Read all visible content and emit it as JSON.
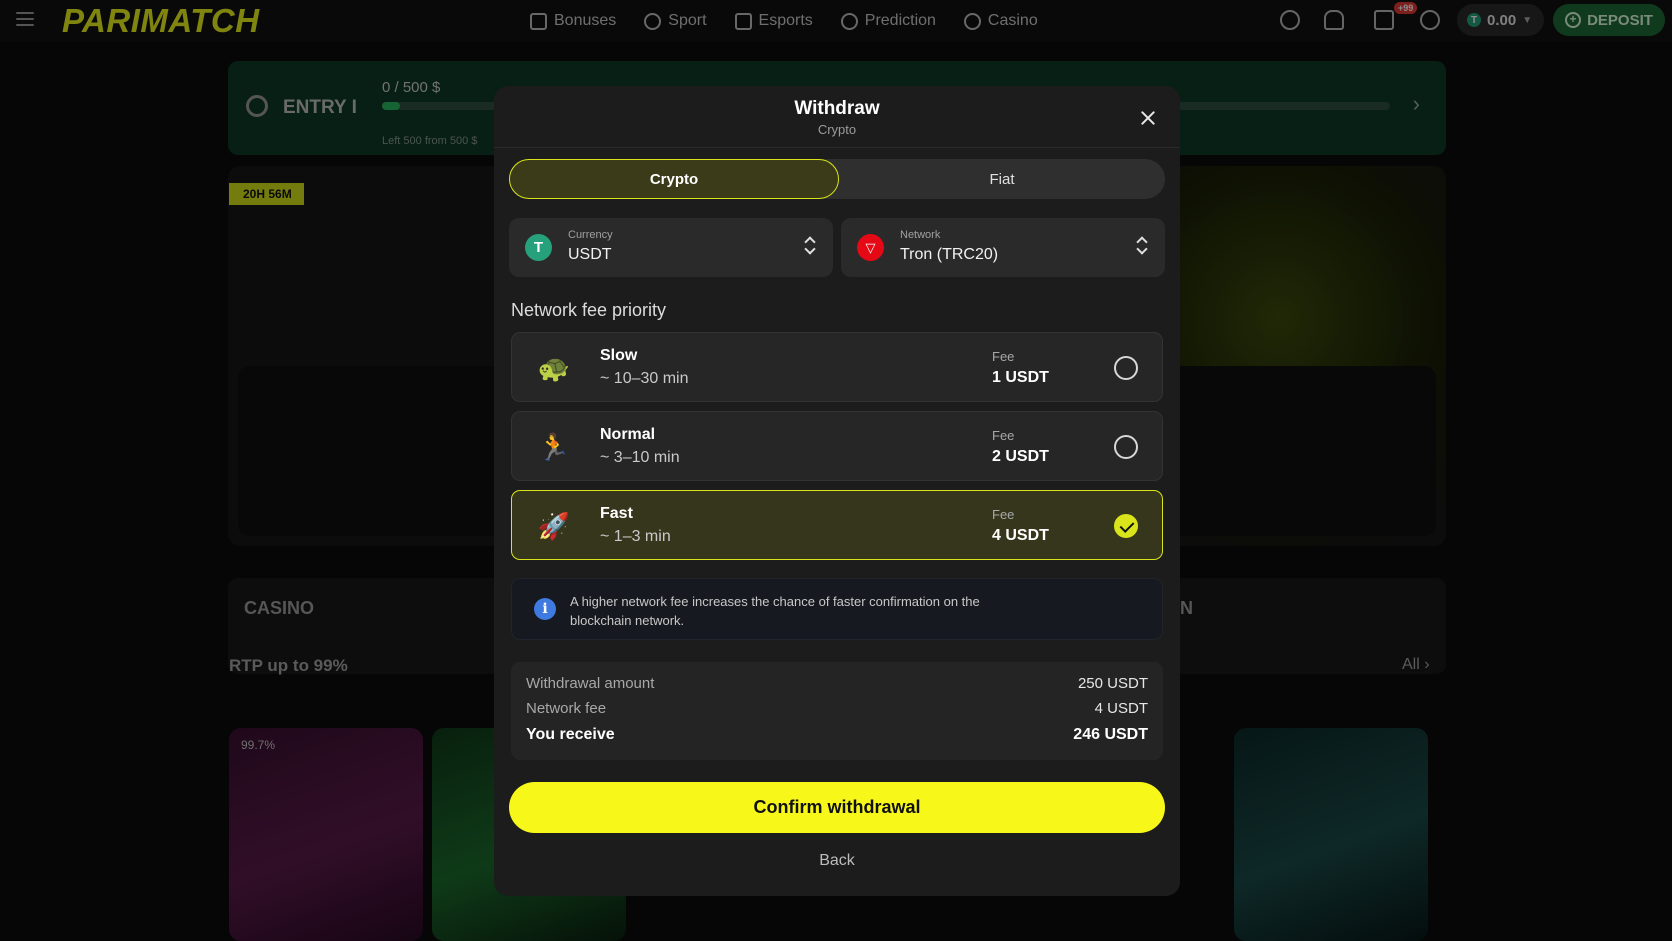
{
  "topbar": {
    "logo": "PARIMATCH",
    "nav": [
      {
        "label": "Bonuses",
        "icon": "gift-icon"
      },
      {
        "label": "Sport",
        "icon": "ball-icon"
      },
      {
        "label": "Esports",
        "icon": "gamepad-icon"
      },
      {
        "label": "Prediction",
        "icon": "prediction-icon"
      },
      {
        "label": "Casino",
        "icon": "casino-chip-icon"
      }
    ],
    "messages_badge": "+99",
    "balance": "0.00",
    "deposit_label": "DEPOSIT"
  },
  "background": {
    "entry_title": "ENTRY I",
    "entry_amount": "0 / 500  $",
    "entry_sub": "Left 500 from 500 $",
    "timer": "20H 56M",
    "category_casino": "CASINO",
    "category_right": "N",
    "rtp_title": "RTP up to 99%",
    "all_link": "All",
    "game_rtp": "99.7%"
  },
  "modal": {
    "title": "Withdraw",
    "subtitle": "Crypto",
    "tabs": [
      {
        "label": "Crypto",
        "active": true
      },
      {
        "label": "Fiat",
        "active": false
      }
    ],
    "currency": {
      "label": "Currency",
      "value": "USDT",
      "icon": "tether-icon"
    },
    "network": {
      "label": "Network",
      "value": "Tron (TRC20)",
      "icon": "tron-icon"
    },
    "fee_section_title": "Network fee priority",
    "fee_options": [
      {
        "name": "Slow",
        "time": "~ 10–30 min",
        "fee_label": "Fee",
        "fee": "1 USDT",
        "icon": "turtle-icon",
        "selected": false
      },
      {
        "name": "Normal",
        "time": "~ 3–10 min",
        "fee_label": "Fee",
        "fee": "2 USDT",
        "icon": "runner-icon",
        "selected": false
      },
      {
        "name": "Fast",
        "time": "~ 1–3 min",
        "fee_label": "Fee",
        "fee": "4 USDT",
        "icon": "rocket-icon",
        "selected": true
      }
    ],
    "info_text": "A higher network fee increases the chance of faster confirmation on the blockchain network.",
    "summary": {
      "withdrawal_amount_label": "Withdrawal amount",
      "withdrawal_amount": "250 USDT",
      "network_fee_label": "Network fee",
      "network_fee": "4 USDT",
      "you_receive_label": "You receive",
      "you_receive": "246 USDT"
    },
    "confirm_label": "Confirm withdrawal",
    "back_label": "Back"
  },
  "colors": {
    "accent": "#d9e51a",
    "confirm": "#f7f71a",
    "deposit": "#1e6b37",
    "tether": "#26a17b",
    "tron": "#e50915",
    "info": "#3f7ae0"
  }
}
